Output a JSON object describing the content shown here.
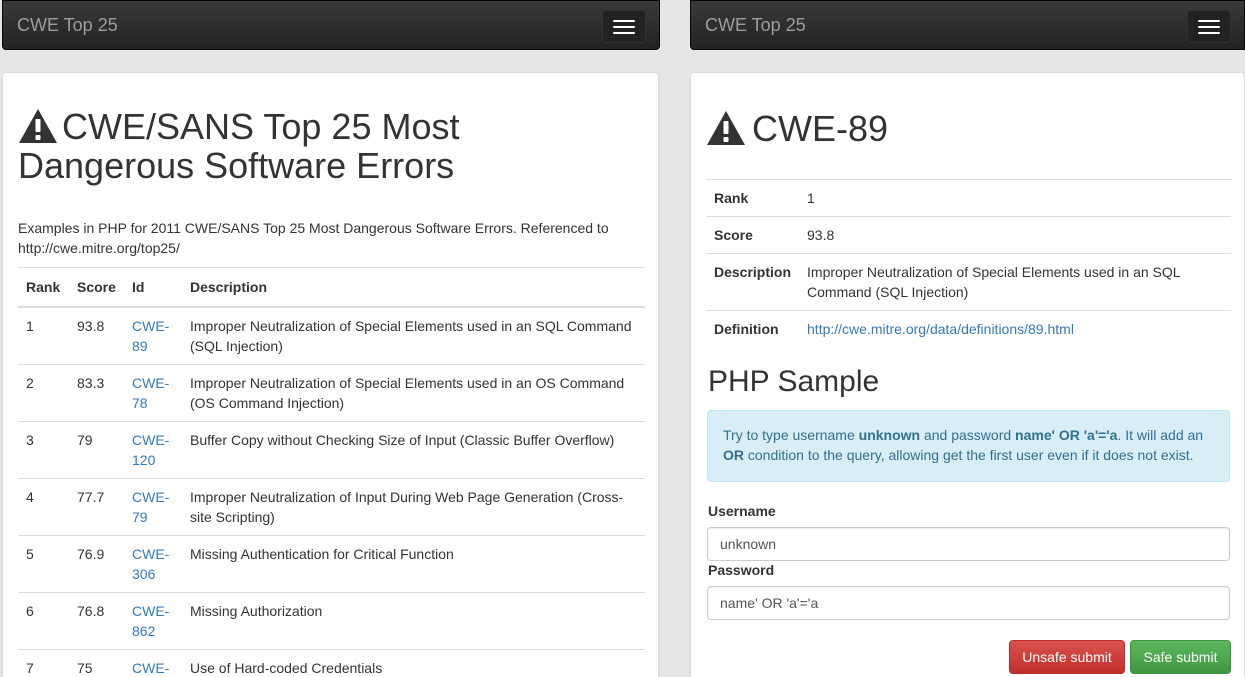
{
  "left": {
    "brand": "CWE Top 25",
    "title": "CWE/SANS Top 25 Most Dangerous Software Errors",
    "intro": "Examples in PHP for 2011 CWE/SANS Top 25 Most Dangerous Software Errors. Referenced to http://cwe.mitre.org/top25/",
    "table": {
      "headers": [
        "Rank",
        "Score",
        "Id",
        "Description"
      ],
      "rows": [
        {
          "rank": "1",
          "score": "93.8",
          "id": "CWE-89",
          "desc": "Improper Neutralization of Special Elements used in an SQL Command (SQL Injection)"
        },
        {
          "rank": "2",
          "score": "83.3",
          "id": "CWE-78",
          "desc": "Improper Neutralization of Special Elements used in an OS Command (OS Command Injection)"
        },
        {
          "rank": "3",
          "score": "79",
          "id": "CWE-120",
          "desc": "Buffer Copy without Checking Size of Input (Classic Buffer Overflow)"
        },
        {
          "rank": "4",
          "score": "77.7",
          "id": "CWE-79",
          "desc": "Improper Neutralization of Input During Web Page Generation (Cross-site Scripting)"
        },
        {
          "rank": "5",
          "score": "76.9",
          "id": "CWE-306",
          "desc": "Missing Authentication for Critical Function"
        },
        {
          "rank": "6",
          "score": "76.8",
          "id": "CWE-862",
          "desc": "Missing Authorization"
        },
        {
          "rank": "7",
          "score": "75",
          "id": "CWE-",
          "desc": "Use of Hard-coded Credentials"
        }
      ]
    }
  },
  "right": {
    "brand": "CWE Top 25",
    "title": "CWE-89",
    "details": {
      "rank_label": "Rank",
      "rank": "1",
      "score_label": "Score",
      "score": "93.8",
      "description_label": "Description",
      "description": "Improper Neutralization of Special Elements used in an SQL Command (SQL Injection)",
      "definition_label": "Definition",
      "definition": "http://cwe.mitre.org/data/definitions/89.html"
    },
    "sample_title": "PHP Sample",
    "alert": {
      "t1": "Try to type username ",
      "b1": "unknown",
      "t2": " and password ",
      "b2": "name' OR 'a'='a",
      "t3": ". It will add an ",
      "b3": "OR",
      "t4": " condition to the query, allowing get the first user even if it does not exist."
    },
    "form": {
      "username_label": "Username",
      "username_value": "unknown",
      "password_label": "Password",
      "password_value": "name' OR 'a'='a",
      "unsafe_label": "Unsafe submit",
      "safe_label": "Safe submit"
    }
  },
  "colors": {
    "navbar": "#222222",
    "link": "#337ab7",
    "danger": "#d9534f",
    "success": "#5cb85c",
    "alert_bg": "#d9edf7"
  },
  "icons": [
    "warning-triangle-icon",
    "hamburger-menu-icon"
  ]
}
